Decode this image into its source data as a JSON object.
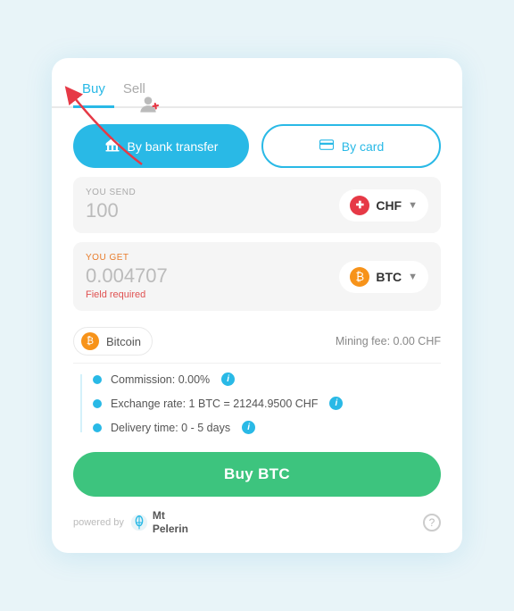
{
  "tabs": {
    "buy": "Buy",
    "sell": "Sell"
  },
  "payment": {
    "bank_label": "By bank transfer",
    "card_label": "By card"
  },
  "send": {
    "label": "YOU SEND",
    "value": "100",
    "currency_name": "CHF",
    "currency_icon": "+"
  },
  "receive": {
    "label": "YOU GET",
    "value": "0.004707",
    "field_required": "Field required",
    "currency_name": "BTC",
    "currency_icon": "₿"
  },
  "crypto_row": {
    "name": "Bitcoin",
    "mining_fee": "Mining fee: 0.00 CHF"
  },
  "details": {
    "commission": "Commission: 0.00%",
    "exchange_rate": "Exchange rate: 1 BTC = 21244.9500 CHF",
    "delivery": "Delivery time: 0 - 5 days"
  },
  "buy_button": "Buy BTC",
  "footer": {
    "powered_by": "powered by",
    "brand": "Mt\nPelerin"
  }
}
